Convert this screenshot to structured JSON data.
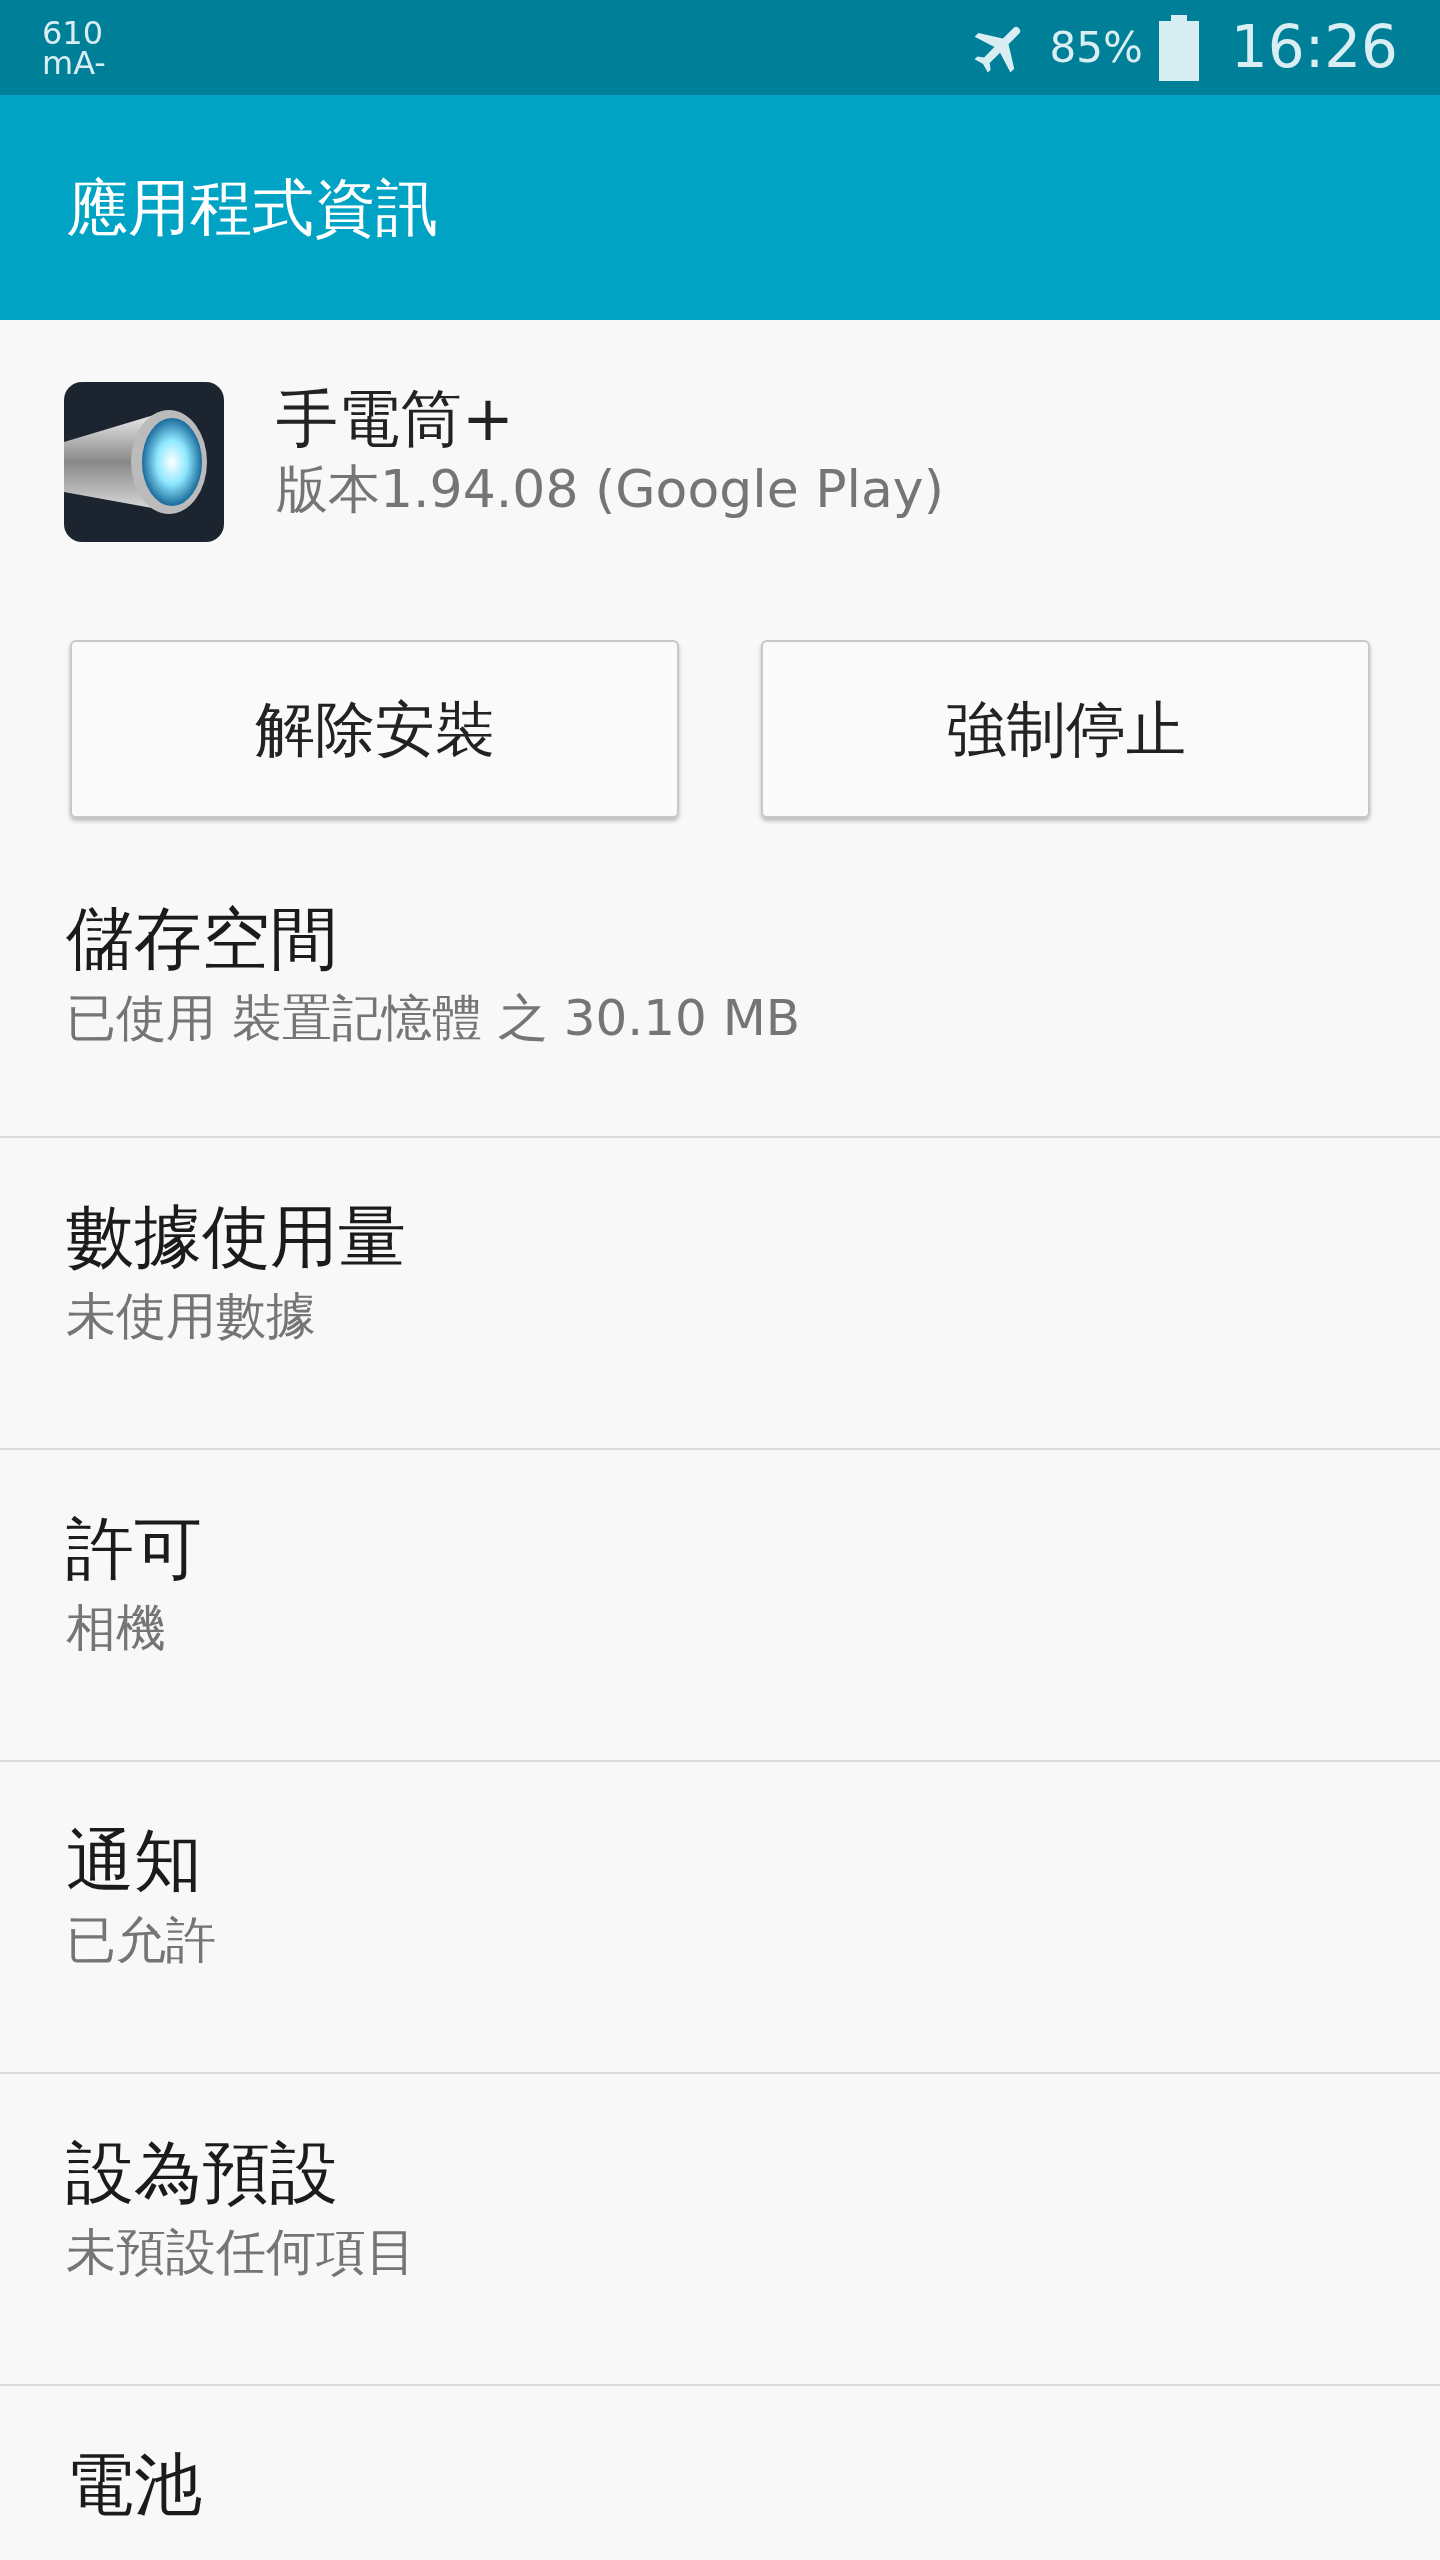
{
  "status_bar": {
    "current_reading": "610",
    "current_unit": "mA-",
    "battery_percent": "85%",
    "time": "16:26"
  },
  "app_bar": {
    "title": "應用程式資訊"
  },
  "app": {
    "name": "手電筒+",
    "version": "版本1.94.08 (Google Play)"
  },
  "buttons": [
    "解除安裝",
    "強制停止"
  ],
  "sections": [
    {
      "title": "儲存空間",
      "subtitle": "已使用 裝置記憶體 之 30.10 MB"
    },
    {
      "title": "數據使用量",
      "subtitle": "未使用數據"
    },
    {
      "title": "許可",
      "subtitle": "相機"
    },
    {
      "title": "通知",
      "subtitle": "已允許"
    },
    {
      "title": "設為預設",
      "subtitle": "未預設任何項目"
    },
    {
      "title": "電池"
    }
  ]
}
